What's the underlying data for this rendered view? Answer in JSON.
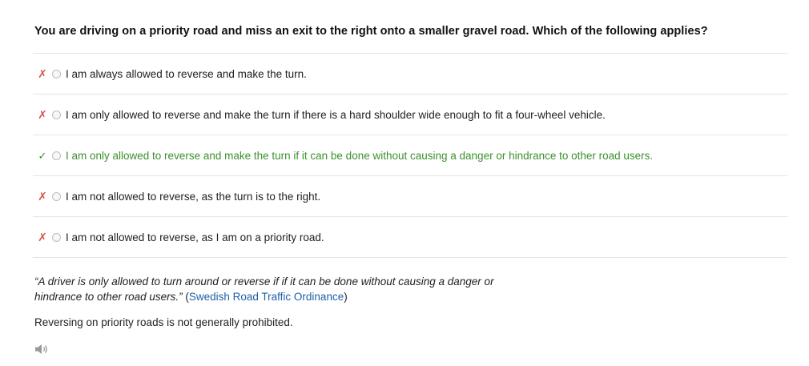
{
  "question": "You are driving on a priority road and miss an exit to the right onto a smaller gravel road. Which of the following applies?",
  "options": [
    {
      "mark": "✗",
      "status": "wrong",
      "text": "I am always allowed to reverse and make the turn."
    },
    {
      "mark": "✗",
      "status": "wrong",
      "text": "I am only allowed to reverse and make the turn if there is a hard shoulder wide enough to fit a four-wheel vehicle."
    },
    {
      "mark": "✓",
      "status": "correct",
      "text": "I am only allowed to reverse and make the turn if it can be done without causing a danger or hindrance to other road users."
    },
    {
      "mark": "✗",
      "status": "wrong",
      "text": "I am not allowed to reverse, as the turn is to the right."
    },
    {
      "mark": "✗",
      "status": "wrong",
      "text": "I am not allowed to reverse, as I am on a priority road."
    }
  ],
  "explanation": {
    "quote_line1": "“A driver is only allowed to turn around or reverse if if it can be done without causing a danger or",
    "quote_line2": "hindrance to other road users.”",
    "source_open": " (",
    "source_link": "Swedish Road Traffic Ordinance",
    "source_close": ")"
  },
  "note": "Reversing on priority roads is not generally prohibited.",
  "icons": {
    "speaker": "speaker-icon",
    "wrong": "cross-icon",
    "correct": "check-icon"
  },
  "colors": {
    "correct": "#3c8f2e",
    "wrong": "#d9534f",
    "link": "#1f5fa8"
  }
}
